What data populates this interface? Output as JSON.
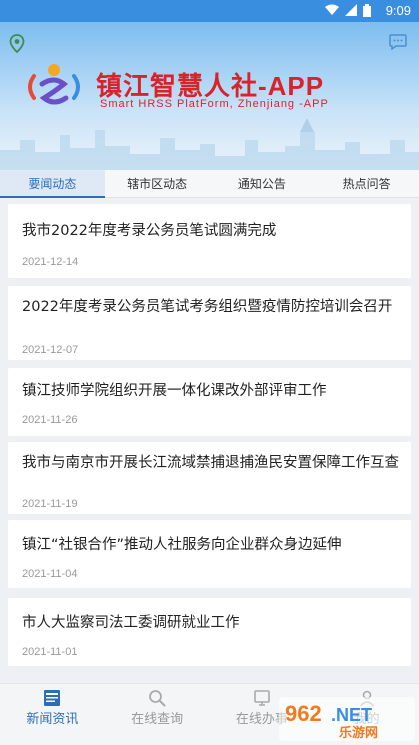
{
  "status_bar": {
    "time": "9:09",
    "icons": [
      "wifi-icon",
      "signal-icon",
      "battery-icon"
    ]
  },
  "header": {
    "brand_title": "镇江智慧人社-APP",
    "brand_subtitle": "Smart HRSS PlatForm, Zhenjiang -APP",
    "icons": [
      "location-icon",
      "chat-icon"
    ]
  },
  "tabs": [
    {
      "label": "要闻动态",
      "active": true
    },
    {
      "label": "辖市区动态",
      "active": false
    },
    {
      "label": "通知公告",
      "active": false
    },
    {
      "label": "热点问答",
      "active": false
    }
  ],
  "news": [
    {
      "title": "我市2022年度考录公务员笔试圆满完成",
      "date": "2021-12-14"
    },
    {
      "title": "2022年度考录公务员笔试考务组织暨疫情防控培训会召开",
      "date": "2021-12-07"
    },
    {
      "title": "镇江技师学院组织开展一体化课改外部评审工作",
      "date": "2021-11-26"
    },
    {
      "title": "我市与南京市开展长江流域禁捕退捕渔民安置保障工作互查",
      "date": "2021-11-19"
    },
    {
      "title": "镇江“社银合作”推动人社服务向企业群众身边延伸",
      "date": "2021-11-04"
    },
    {
      "title": "市人大监察司法工委调研就业工作",
      "date": "2021-11-01"
    }
  ],
  "bottom_nav": [
    {
      "label": "新闻资讯",
      "icon": "news-icon",
      "active": true
    },
    {
      "label": "在线查询",
      "icon": "search-icon",
      "active": false
    },
    {
      "label": "在线办事",
      "icon": "service-icon",
      "active": false
    },
    {
      "label": "我的",
      "icon": "user-icon",
      "active": false
    }
  ],
  "watermark": {
    "logo": "962.NET",
    "text": "乐游网"
  },
  "colors": {
    "accent": "#2c6fb7",
    "brand_red": "#d9232a",
    "status_bar": "#3a8ee0"
  }
}
